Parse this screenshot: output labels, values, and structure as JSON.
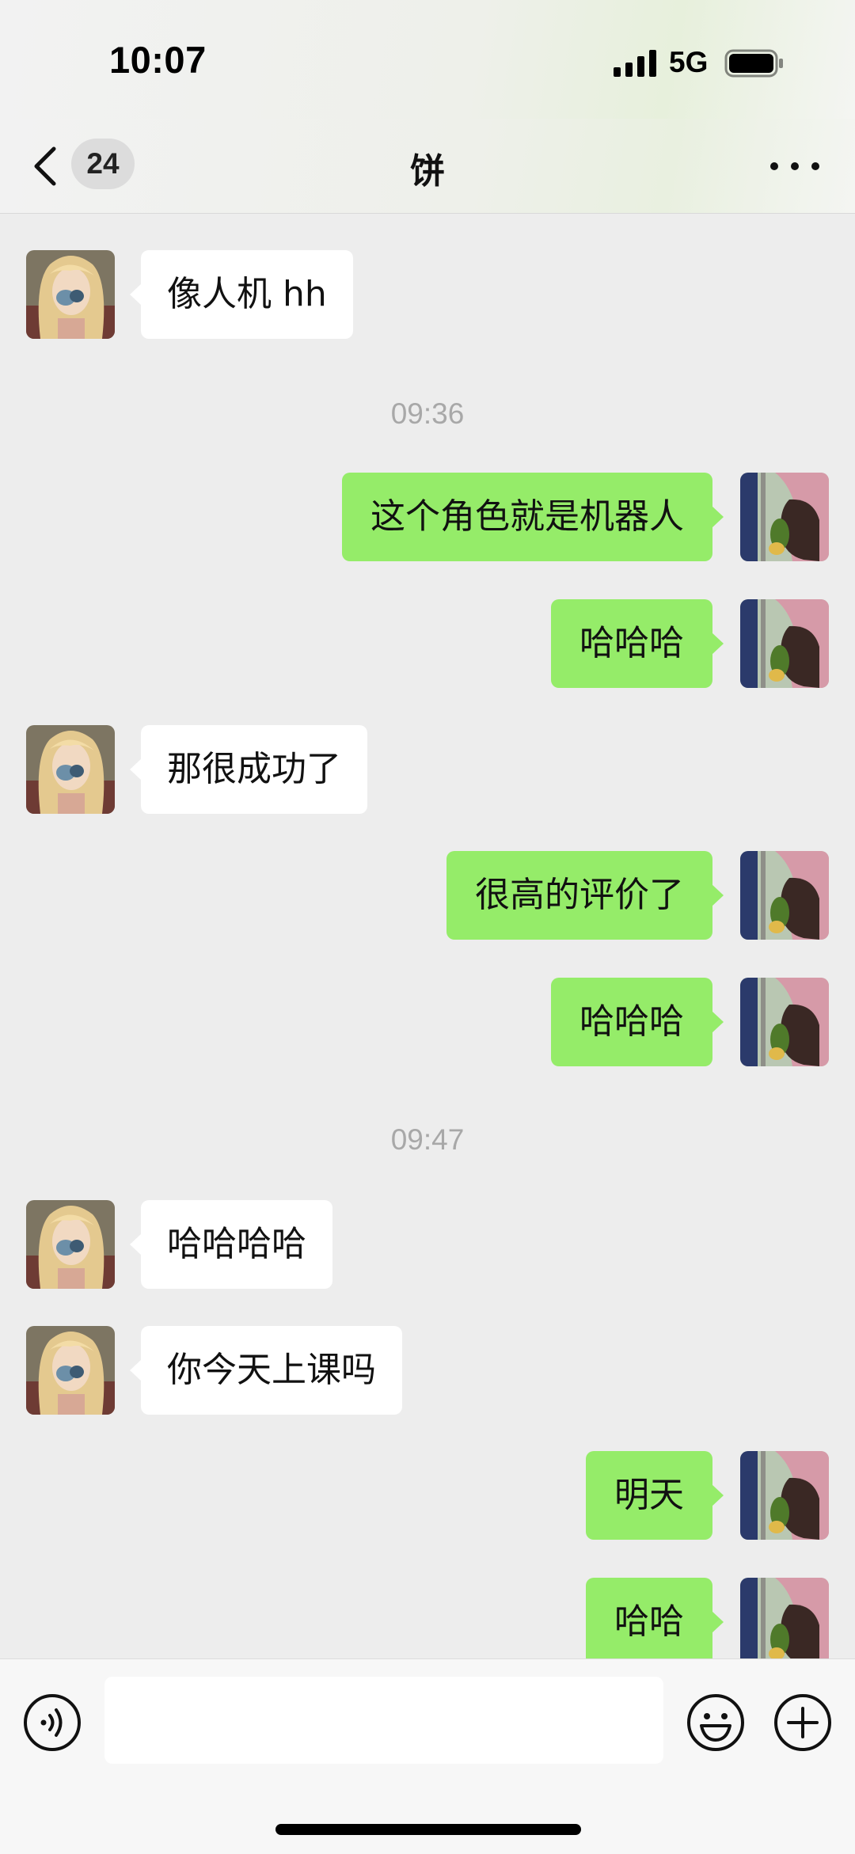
{
  "status_bar": {
    "time": "10:07",
    "network": "5G",
    "signal_icon": "cellular-signal-icon",
    "battery_icon": "battery-icon"
  },
  "nav": {
    "back_icon": "chevron-left-icon",
    "unread_count": "24",
    "title": "饼",
    "more_icon": "more-dots-icon"
  },
  "messages": [
    {
      "from": "friend",
      "text": "像人机 hh"
    },
    {
      "timestamp": "09:36"
    },
    {
      "from": "me",
      "text": "这个角色就是机器人"
    },
    {
      "from": "me",
      "text": "哈哈哈"
    },
    {
      "from": "friend",
      "text": "那很成功了"
    },
    {
      "from": "me",
      "text": "很高的评价了"
    },
    {
      "from": "me",
      "text": "哈哈哈"
    },
    {
      "timestamp": "09:47"
    },
    {
      "from": "friend",
      "text": "哈哈哈哈"
    },
    {
      "from": "friend",
      "text": "你今天上课吗"
    },
    {
      "from": "me",
      "text": "明天"
    },
    {
      "from": "me",
      "text": "哈哈"
    }
  ],
  "input_bar": {
    "voice_icon": "voice-icon",
    "message_value": "",
    "emoji_icon": "emoji-icon",
    "plus_icon": "plus-circle-icon"
  },
  "colors": {
    "outgoing_bubble": "#95ec69",
    "incoming_bubble": "#ffffff",
    "background": "#ededed",
    "timestamp_text": "#a8a8a8"
  }
}
